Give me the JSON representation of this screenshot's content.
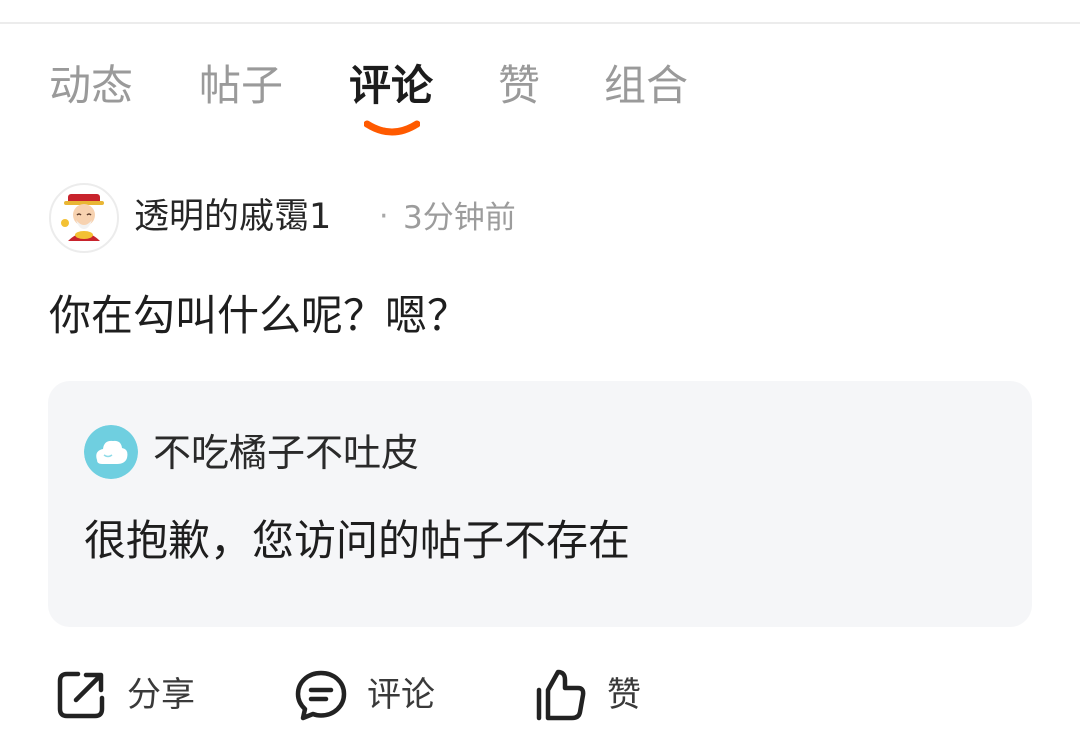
{
  "tabs": [
    {
      "label": "动态"
    },
    {
      "label": "帖子"
    },
    {
      "label": "评论",
      "active": true
    },
    {
      "label": "赞"
    },
    {
      "label": "组合"
    }
  ],
  "comment": {
    "username": "透明的戚霭1",
    "separator": "·",
    "time": "3分钟前",
    "text": "你在勾叫什么呢？嗯？",
    "avatar_icon": "cartoon-fortune-god-avatar"
  },
  "quoted": {
    "username": "不吃橘子不吐皮",
    "text": "很抱歉，您访问的帖子不存在",
    "avatar_icon": "cloud-avatar"
  },
  "actions": {
    "share_label": "分享",
    "comment_label": "评论",
    "like_label": "赞"
  },
  "colors": {
    "accent": "#ff5a00",
    "card_background": "#f5f6f8"
  }
}
